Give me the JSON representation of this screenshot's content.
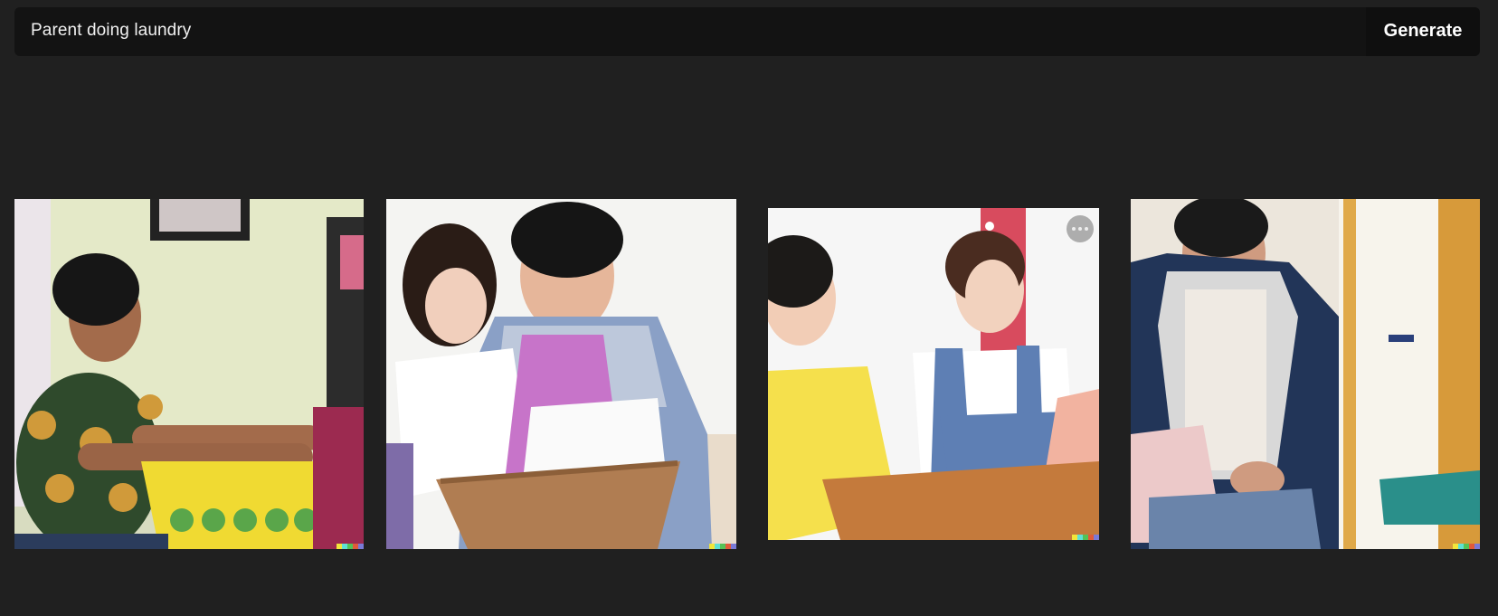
{
  "prompt": {
    "value": "Parent doing laundry",
    "generate_label": "Generate"
  },
  "results": [
    {
      "name": "result-image-1"
    },
    {
      "name": "result-image-2"
    },
    {
      "name": "result-image-3",
      "has_more_button": true
    },
    {
      "name": "result-image-4"
    }
  ],
  "signature_colors": [
    "#f2e63a",
    "#5fe0d4",
    "#54c256",
    "#e05a3a",
    "#7a7ad6"
  ],
  "icons": {
    "more": "more-options-icon"
  }
}
